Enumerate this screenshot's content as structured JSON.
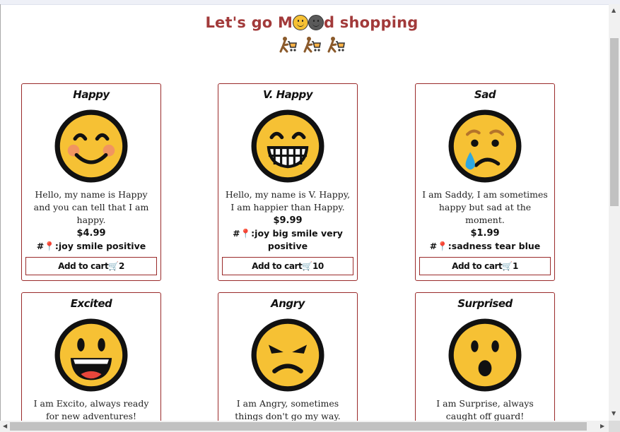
{
  "page": {
    "title_pre": "Let's go M",
    "title_post": "d shopping",
    "shopper_icon": "person-with-cart-icon"
  },
  "colors": {
    "accent": "#a23a3a",
    "border": "#9a2a2a",
    "emoji_yellow": "#f6c134"
  },
  "products": [
    {
      "name": "Happy",
      "desc": "Hello, my name is Happy and you can tell that I am happy.",
      "price": "$4.99",
      "tags": ":joy smile positive",
      "cart_label": "Add to cart",
      "cart_count": "2",
      "icon": "smiling-face-icon"
    },
    {
      "name": "V. Happy",
      "desc": "Hello, my name is V. Happy, I am happier than Happy.",
      "price": "$9.99",
      "tags": ":joy big smile very positive",
      "cart_label": "Add to cart",
      "cart_count": "10",
      "icon": "grinning-face-icon"
    },
    {
      "name": "Sad",
      "desc": "I am Saddy, I am sometimes happy but sad at the moment.",
      "price": "$1.99",
      "tags": ":sadness tear blue",
      "cart_label": "Add to cart",
      "cart_count": "1",
      "icon": "crying-face-icon"
    },
    {
      "name": "Excited",
      "desc": "I am Excito, always ready for new adventures!",
      "icon": "excited-face-icon"
    },
    {
      "name": "Angry",
      "desc": "I am Angry, sometimes things don't go my way.",
      "icon": "angry-face-icon"
    },
    {
      "name": "Surprised",
      "desc": "I am Surprise, always caught off guard!",
      "icon": "surprised-face-icon"
    }
  ],
  "tag_prefix": "#"
}
